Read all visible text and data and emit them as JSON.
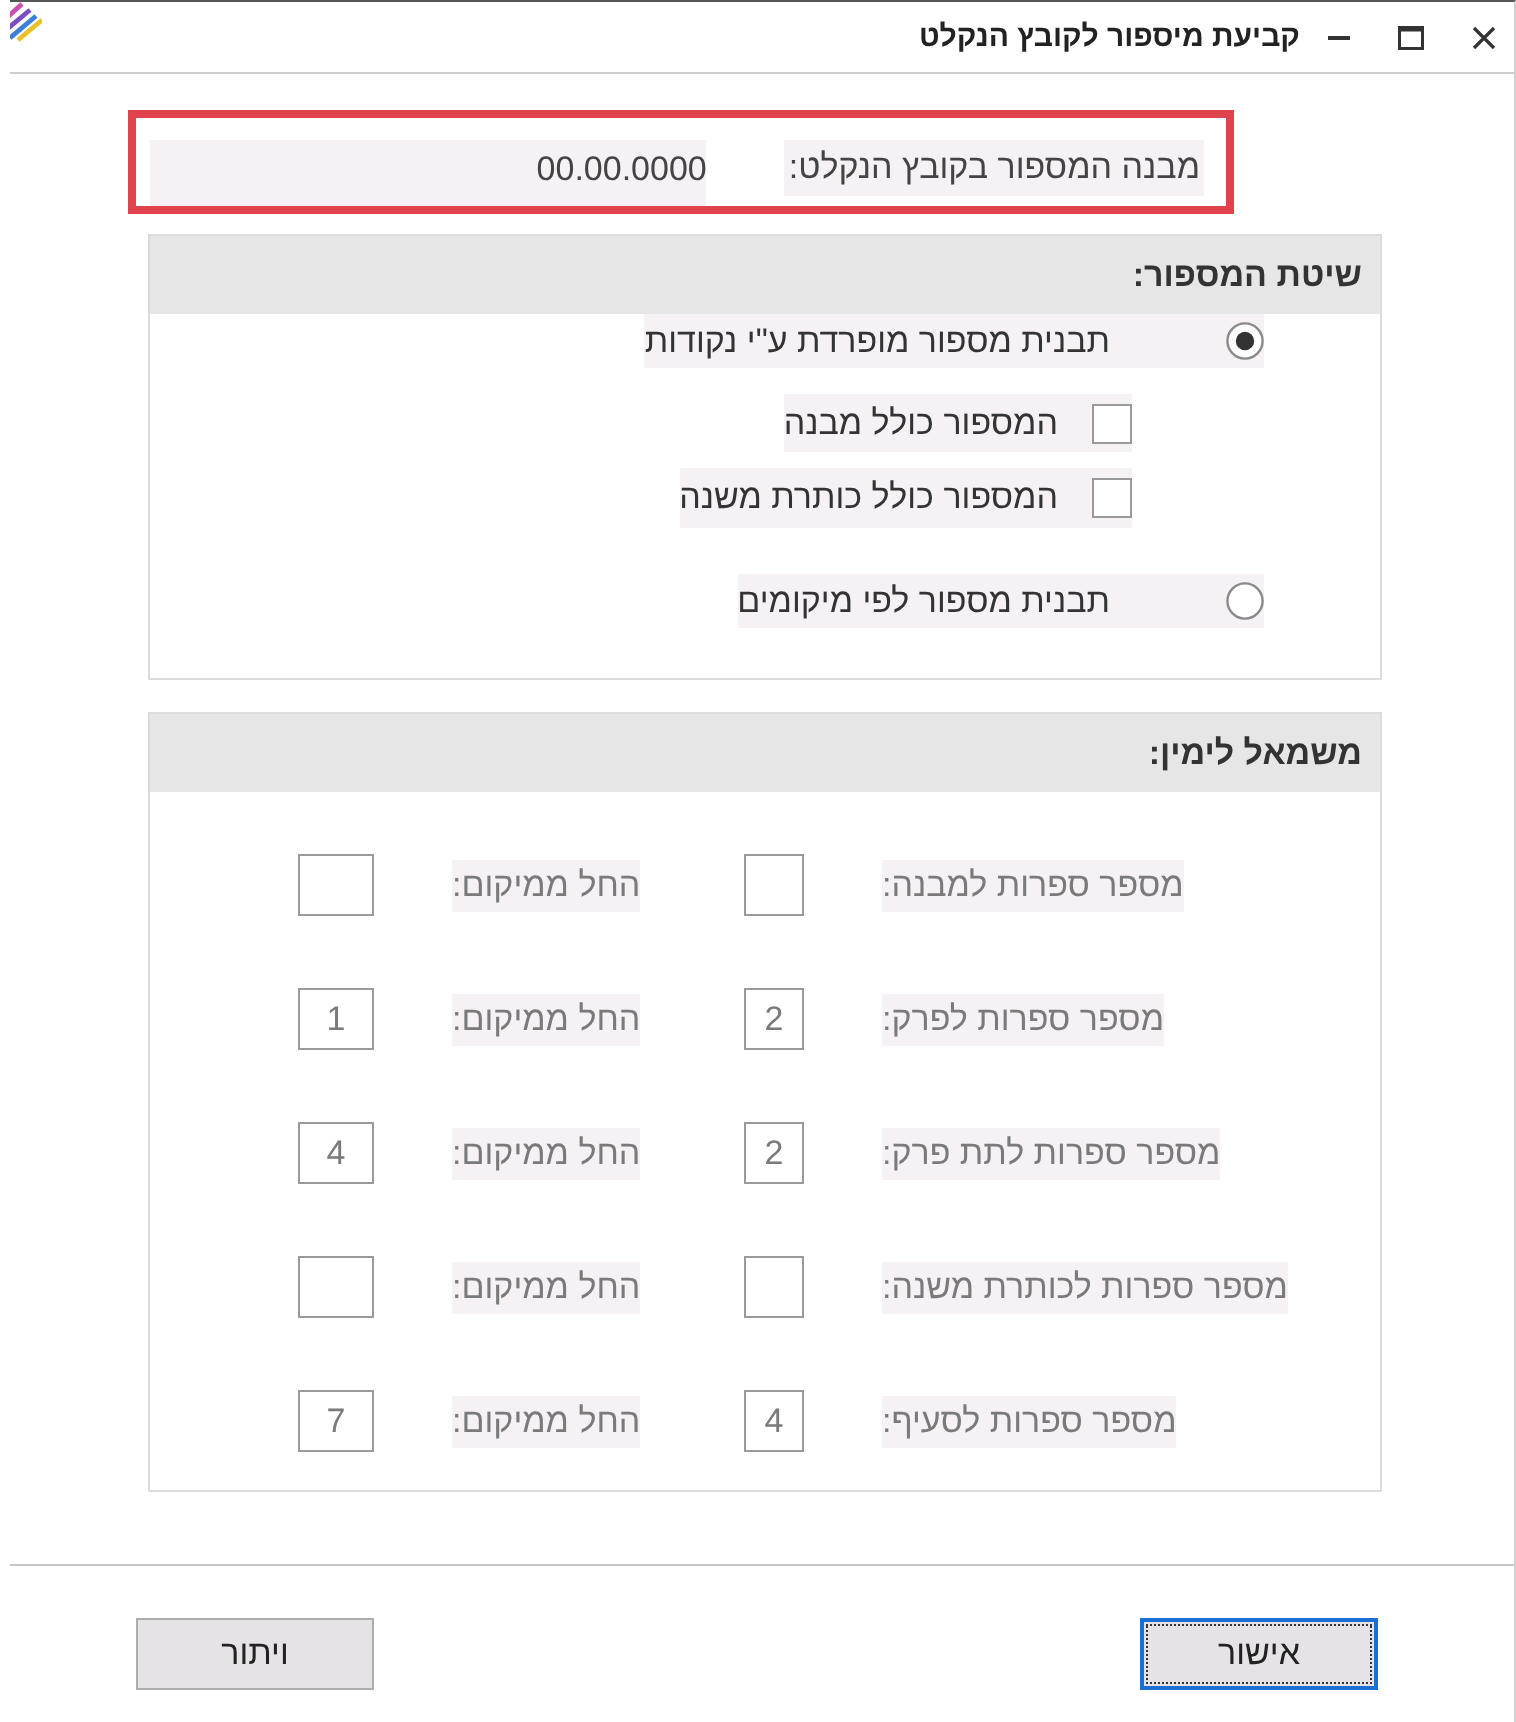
{
  "window": {
    "title": "קביעת מיספור לקובץ הנקלט"
  },
  "format_field": {
    "label": "מבנה המספור בקובץ הנקלט:",
    "value": "00.00.0000",
    "highlighted": true
  },
  "numbering_method": {
    "title": "שיטת המספור:",
    "options": [
      {
        "label": "תבנית מספור מופרדת ע\"י נקודות",
        "selected": true,
        "checkboxes": [
          {
            "label": "המספור כולל מבנה",
            "checked": false
          },
          {
            "label": "המספור כולל כותרת משנה",
            "checked": false
          }
        ]
      },
      {
        "label": "תבנית מספור לפי מיקומים",
        "selected": false
      }
    ]
  },
  "positions": {
    "title": "משמאל לימין:",
    "disabled": true,
    "rows": [
      {
        "label": "מספר ספרות למבנה:",
        "start_label": "החל ממיקום:"
      },
      {
        "label": "מספר ספרות לפרק:",
        "digits": "2",
        "start_label": "החל ממיקום:",
        "start": "1"
      },
      {
        "label": "מספר ספרות לתת פרק:",
        "digits": "2",
        "start_label": "החל ממיקום:",
        "start": "4"
      },
      {
        "label": "מספר ספרות לכותרת משנה:",
        "start_label": "החל ממיקום:"
      },
      {
        "label": "מספר ספרות לסעיף:",
        "digits": "4",
        "start_label": "החל ממיקום:",
        "start": "7"
      }
    ]
  },
  "buttons": [
    {
      "label": "אישור",
      "focused": true
    },
    {
      "label": "ויתור",
      "focused": false
    }
  ]
}
